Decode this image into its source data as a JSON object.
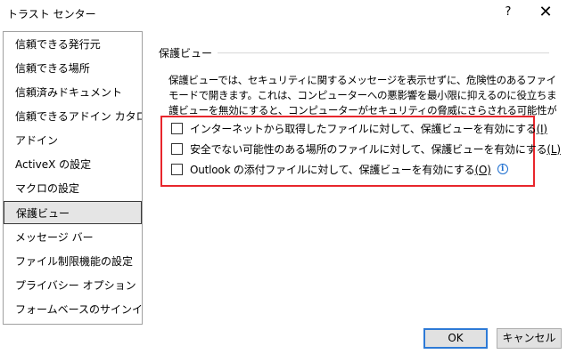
{
  "window": {
    "title": "トラスト センター",
    "help_label": "?",
    "close_label": "✕"
  },
  "sidebar": {
    "items": [
      {
        "label": "信頼できる発行元"
      },
      {
        "label": "信頼できる場所"
      },
      {
        "label": "信頼済みドキュメント"
      },
      {
        "label": "信頼できるアドイン カタログ"
      },
      {
        "label": "アドイン"
      },
      {
        "label": "ActiveX の設定"
      },
      {
        "label": "マクロの設定"
      },
      {
        "label": "保護ビュー",
        "selected": true
      },
      {
        "label": "メッセージ バー"
      },
      {
        "label": "ファイル制限機能の設定"
      },
      {
        "label": "プライバシー オプション"
      },
      {
        "label": "フォームベースのサインイン"
      }
    ]
  },
  "main": {
    "section_title": "保護ビュー",
    "description": [
      "保護ビューでは、セキュリティに関するメッセージを表示せずに、危険性のあるファイルを制限",
      "モードで開きます。これは、コンピューターへの悪影響を最小限に抑えるのに役立ちます。保",
      "護ビューを無効にすると、コンピューターがセキュリティの脅威にさらされる可能性があります。"
    ],
    "options": [
      {
        "label": "インターネットから取得したファイルに対して、保護ビューを有効にする",
        "key": "(I)",
        "checked": false,
        "info": false
      },
      {
        "label": "安全でない可能性のある場所のファイルに対して、保護ビューを有効にする",
        "key": "(L)",
        "checked": false,
        "info": true
      },
      {
        "label": "Outlook の添付ファイルに対して、保護ビューを有効にする",
        "key": "(O)",
        "checked": false,
        "info": true
      }
    ],
    "highlight_color": "#e8262c"
  },
  "footer": {
    "ok_label": "OK",
    "cancel_label": "キャンセル"
  },
  "icons": {
    "info": "i"
  }
}
